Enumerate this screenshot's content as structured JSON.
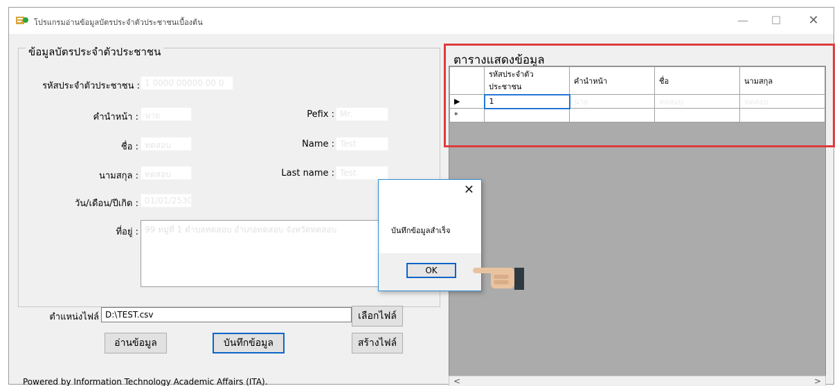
{
  "window": {
    "title": "โปรแกรมอ่านข้อมูลบัตรประจำตัวประชาชนเบื้องต้น",
    "controls": {
      "minimize": "—",
      "maximize": "☐",
      "close": "✕"
    }
  },
  "form": {
    "group_title": "ข้อมูลบัตรประจำตัวประชาชน",
    "labels": {
      "citizen_id": "รหัสประจำตัวประชาชน :",
      "prefix_th": "คำนำหน้า :",
      "prefix_en": "Pefix :",
      "name_th": "ชื่อ :",
      "name_en": "Name :",
      "lastname_th": "นามสกุล :",
      "lastname_en": "Last name :",
      "birthdate": "วัน/เดือน/ปีเกิด :",
      "address": "ที่อยู่ :"
    },
    "values": {
      "citizen_id": "1 0000 00000 00 0",
      "prefix_th": "นาย",
      "prefix_en": "Mr.",
      "name_th": "ทดสอบ",
      "name_en": "Test",
      "lastname_th": "ทดสอบ",
      "lastname_en": "Test",
      "birthdate": "01/01/2530",
      "address": "99 หมู่ที่ 1 ตำบลทดสอบ อำเภอทดสอบ จังหวัดทดสอบ"
    },
    "file_path_label": "ตำแหน่งไฟล์",
    "file_path_value": "D:\\TEST.csv",
    "buttons": {
      "choose_file": "เลือกไฟล์",
      "read_data": "อ่านข้อมูล",
      "save_data": "บันทึกข้อมูล",
      "create_file": "สร้างไฟล์"
    }
  },
  "table": {
    "title": "ตารางแสดงข้อมูล",
    "columns": [
      "รหัสประจำตัว ประชาชน",
      "คำนำหน้า",
      "ชื่อ",
      "นามสกุล"
    ],
    "rows": [
      {
        "marker": "▶",
        "cells": [
          "1",
          "นาย",
          "ทดสอบ",
          "ทดสอบ"
        ]
      },
      {
        "marker": "*",
        "cells": [
          "",
          "",
          "",
          ""
        ]
      }
    ],
    "scroll_left": "<",
    "scroll_right": ">"
  },
  "dialog": {
    "message": "บันทึกข้อมูลสำเร็จ",
    "ok_label": "OK",
    "close": "✕"
  },
  "footer": "Powered by Information Technology Academic Affairs (ITA).",
  "colors": {
    "highlight": "#e03a3a",
    "accent": "#0a64c8"
  }
}
